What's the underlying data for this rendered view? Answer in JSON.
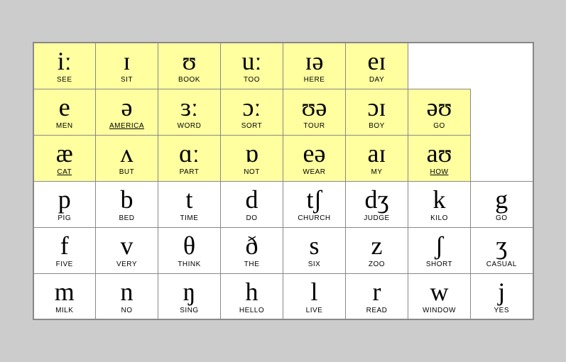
{
  "table": {
    "rows": [
      {
        "type": "vowel",
        "cells": [
          {
            "symbol": "iː",
            "word": "SEE"
          },
          {
            "symbol": "ɪ",
            "word": "SIT"
          },
          {
            "symbol": "ʊ",
            "word": "BOOK"
          },
          {
            "symbol": "uː",
            "word": "TOO"
          },
          {
            "symbol": "ɪə",
            "word": "HERE"
          },
          {
            "symbol": "eɪ",
            "word": "DAY"
          }
        ]
      },
      {
        "type": "vowel",
        "cells": [
          {
            "symbol": "e",
            "word": "MEN"
          },
          {
            "symbol": "ə",
            "word": "AMERICA"
          },
          {
            "symbol": "ɜː",
            "word": "WORD"
          },
          {
            "symbol": "ɔː",
            "word": "SORT"
          },
          {
            "symbol": "ʊə",
            "word": "TOUR"
          },
          {
            "symbol": "ɔɪ",
            "word": "BOY"
          },
          {
            "symbol": "əʊ",
            "word": "GO"
          }
        ]
      },
      {
        "type": "vowel",
        "cells": [
          {
            "symbol": "æ",
            "word": "CAT"
          },
          {
            "symbol": "ʌ",
            "word": "BUT"
          },
          {
            "symbol": "ɑː",
            "word": "PART"
          },
          {
            "symbol": "ɒ",
            "word": "NOT"
          },
          {
            "symbol": "eə",
            "word": "WEAR"
          },
          {
            "symbol": "aɪ",
            "word": "MY"
          },
          {
            "symbol": "aʊ",
            "word": "HOW"
          }
        ]
      },
      {
        "type": "consonant",
        "cells": [
          {
            "symbol": "p",
            "word": "PIG"
          },
          {
            "symbol": "b",
            "word": "BED"
          },
          {
            "symbol": "t",
            "word": "TIME"
          },
          {
            "symbol": "d",
            "word": "DO"
          },
          {
            "symbol": "tʃ",
            "word": "CHURCH"
          },
          {
            "symbol": "dʒ",
            "word": "JUDGE"
          },
          {
            "symbol": "k",
            "word": "KILO"
          },
          {
            "symbol": "g",
            "word": "GO"
          }
        ]
      },
      {
        "type": "consonant",
        "cells": [
          {
            "symbol": "f",
            "word": "FIVE"
          },
          {
            "symbol": "v",
            "word": "VERY"
          },
          {
            "symbol": "θ",
            "word": "THINK"
          },
          {
            "symbol": "ð",
            "word": "THE"
          },
          {
            "symbol": "s",
            "word": "SIX"
          },
          {
            "symbol": "z",
            "word": "ZOO"
          },
          {
            "symbol": "ʃ",
            "word": "SHORT"
          },
          {
            "symbol": "ʒ",
            "word": "CASUAL"
          }
        ]
      },
      {
        "type": "consonant",
        "cells": [
          {
            "symbol": "m",
            "word": "MILK"
          },
          {
            "symbol": "n",
            "word": "NO"
          },
          {
            "symbol": "ŋ",
            "word": "SING"
          },
          {
            "symbol": "h",
            "word": "HELLO"
          },
          {
            "symbol": "l",
            "word": "LIVE"
          },
          {
            "symbol": "r",
            "word": "READ"
          },
          {
            "symbol": "w",
            "word": "WINDOW"
          },
          {
            "symbol": "j",
            "word": "YES"
          }
        ]
      }
    ]
  }
}
